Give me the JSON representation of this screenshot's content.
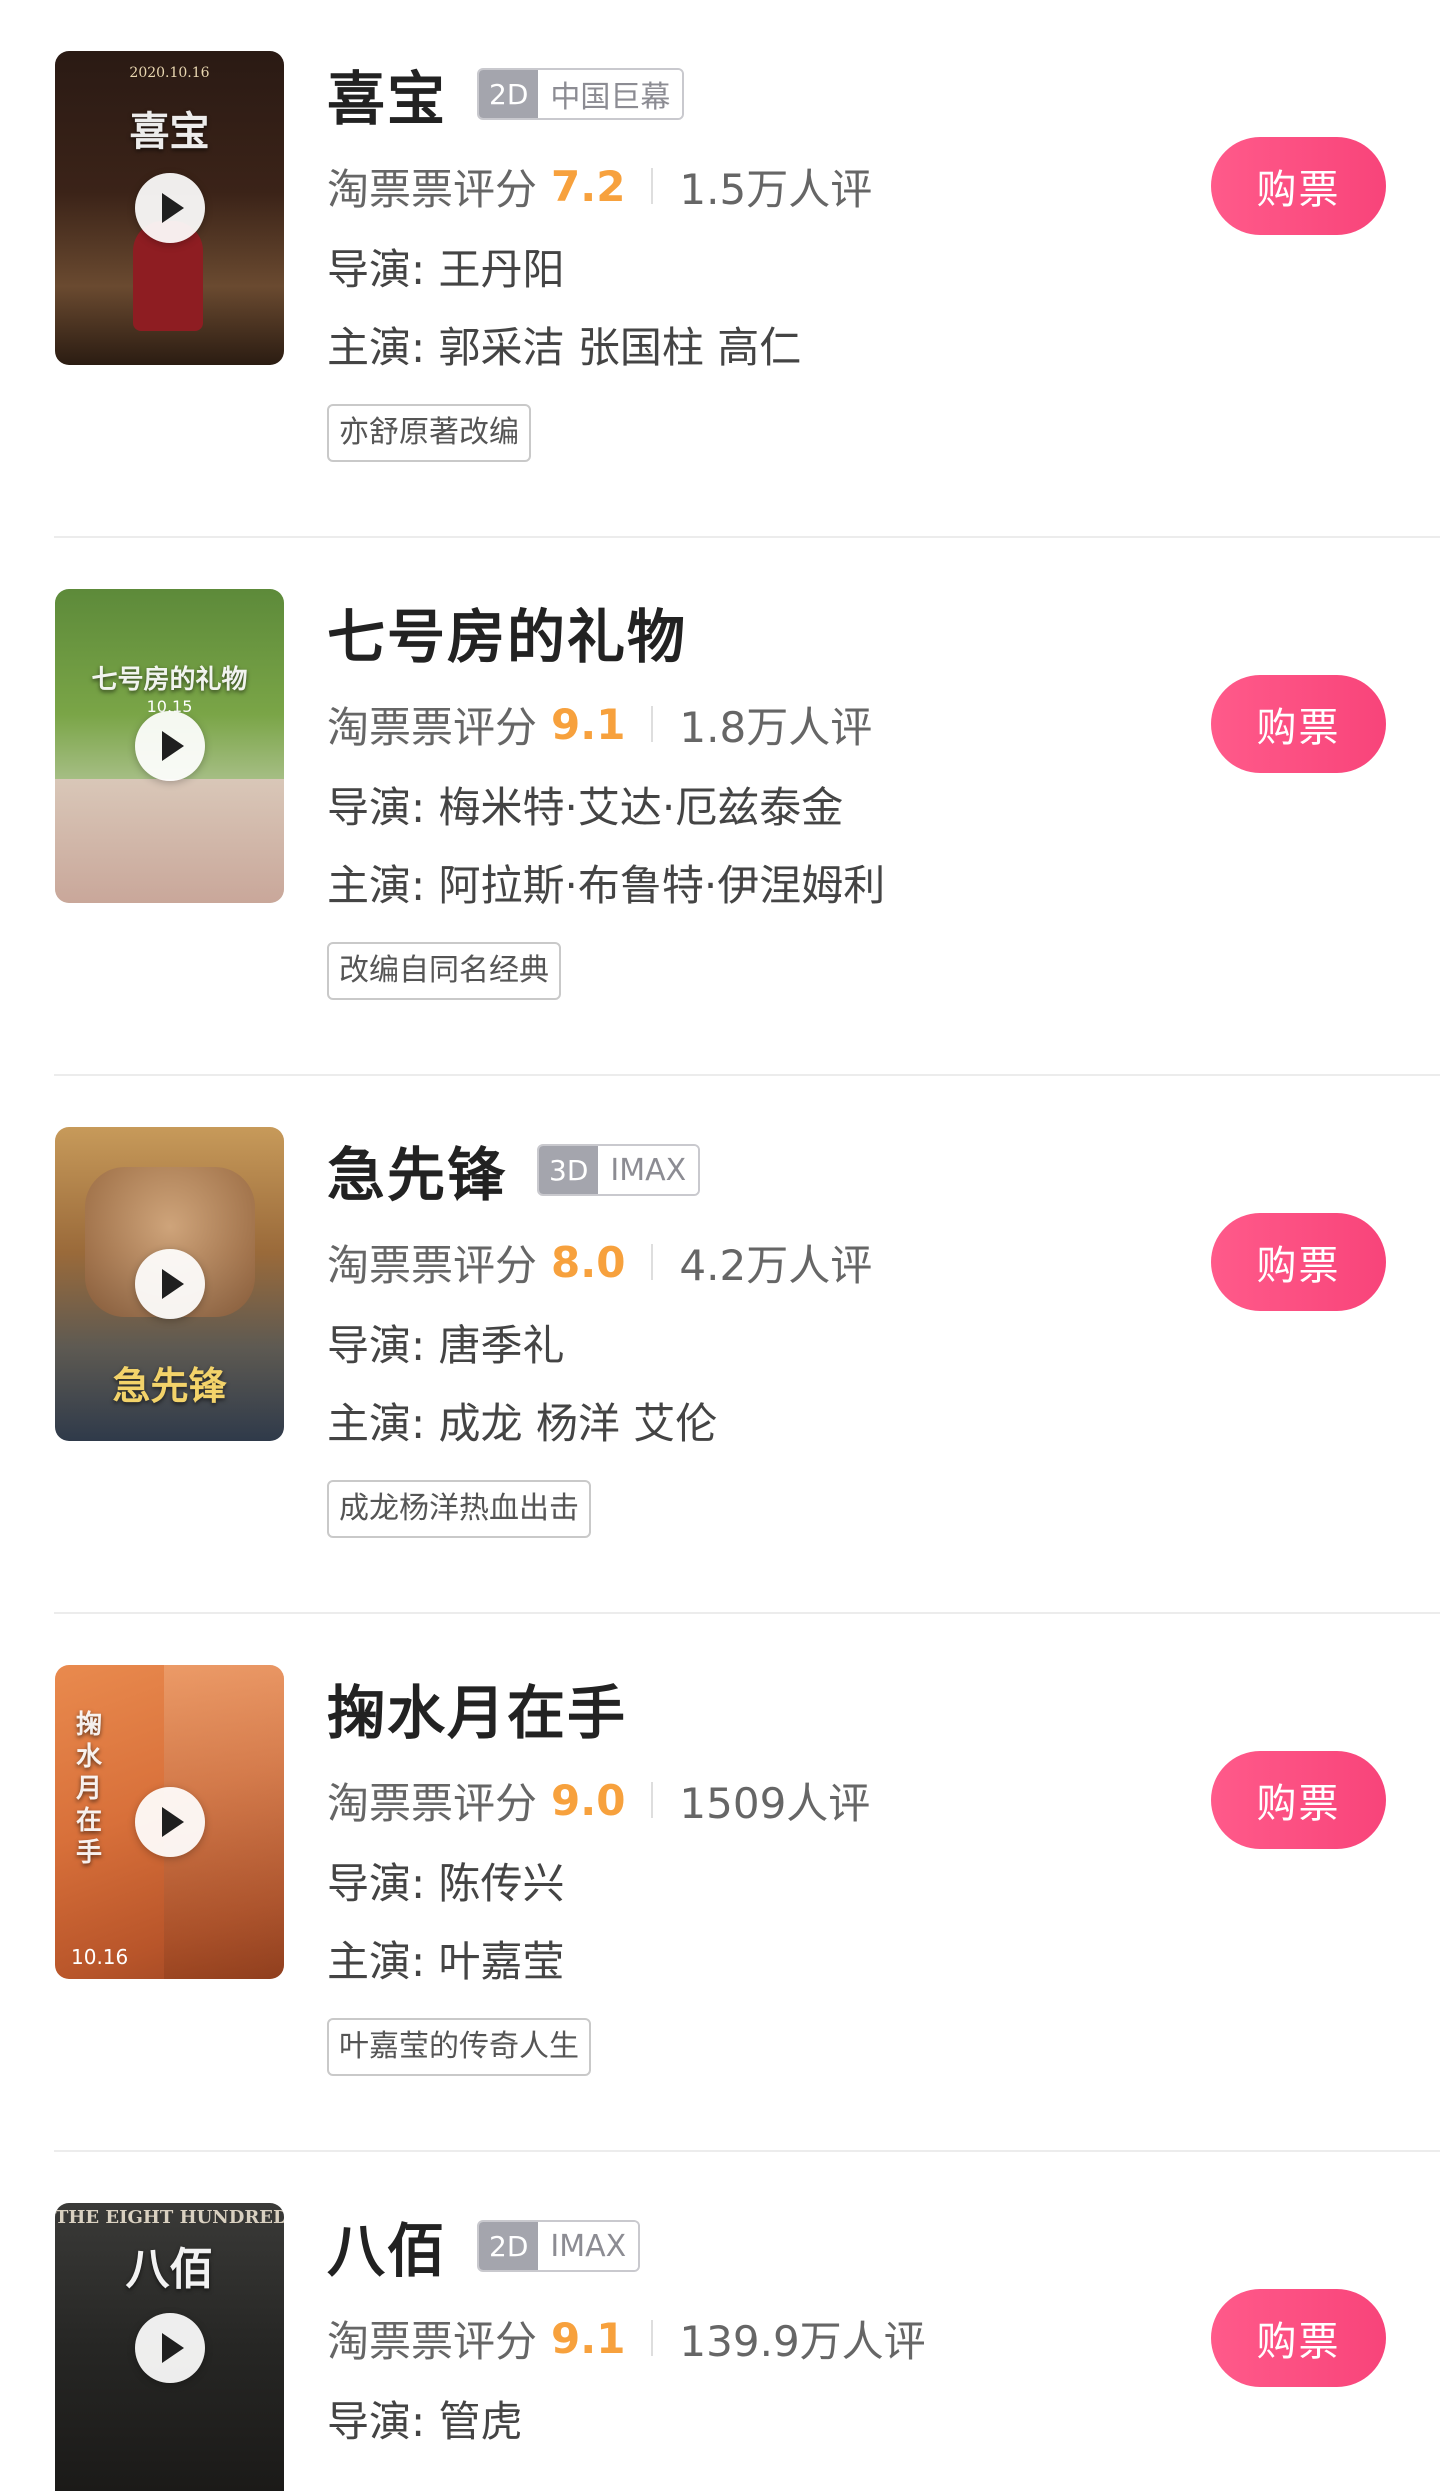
{
  "rating_label": "淘票票评分",
  "director_label": "导演:",
  "cast_label": "主演:",
  "buy_label": "购票",
  "movies": [
    {
      "title": "喜宝",
      "dim": "2D",
      "format": "中国巨幕",
      "score": "7.2",
      "count": "1.5万人评",
      "director": "王丹阳",
      "cast": "郭采洁 张国柱 高仁",
      "badge": "亦舒原著改编",
      "poster_date": "2020.10.16",
      "poster_title": "喜宝"
    },
    {
      "title": "七号房的礼物",
      "dim": "",
      "format": "",
      "score": "9.1",
      "count": "1.8万人评",
      "director": "梅米特·艾达·厄兹泰金",
      "cast": "阿拉斯·布鲁特·伊涅姆利",
      "badge": "改编自同名经典",
      "poster_title": "七号房的礼物",
      "poster_sub": "10.15"
    },
    {
      "title": "急先锋",
      "dim": "3D",
      "format": "IMAX",
      "score": "8.0",
      "count": "4.2万人评",
      "director": "唐季礼",
      "cast": "成龙 杨洋 艾伦",
      "badge": "成龙杨洋热血出击",
      "poster_title": "急先锋"
    },
    {
      "title": "掬水月在手",
      "dim": "",
      "format": "",
      "score": "9.0",
      "count": "1509人评",
      "director": "陈传兴",
      "cast": "叶嘉莹",
      "badge": "叶嘉莹的传奇人生",
      "poster_title": "掬水月在手",
      "poster_sub": "10.16"
    },
    {
      "title": "八佰",
      "dim": "2D",
      "format": "IMAX",
      "score": "9.1",
      "count": "139.9万人评",
      "director": "管虎",
      "cast": "",
      "badge": "",
      "poster_title": "八佰",
      "poster_sub": "THE EIGHT HUNDRED"
    }
  ]
}
